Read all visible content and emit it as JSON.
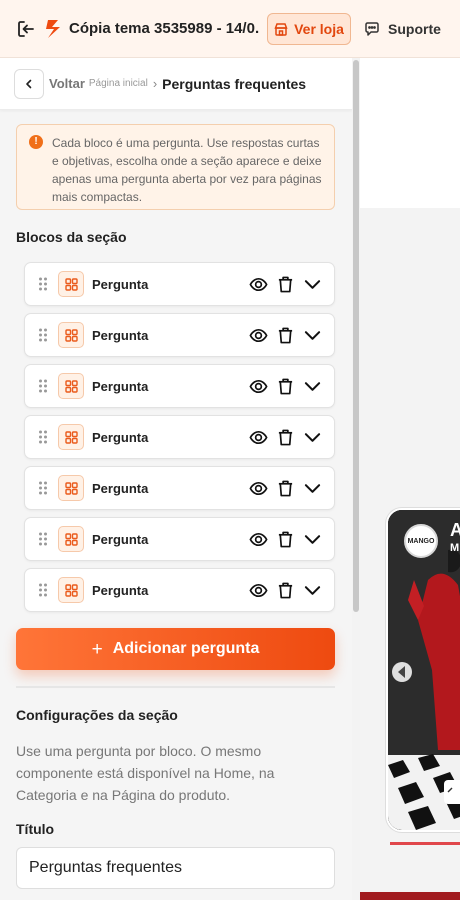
{
  "topbar": {
    "title": "Cópia tema 3535989 - 14/0...",
    "ver_loja": "Ver loja",
    "suporte": "Suporte",
    "accent": "#e2470e"
  },
  "breadcrumb": {
    "voltar": "Voltar",
    "home": "Página inicial",
    "separator": "›",
    "current": "Perguntas frequentes"
  },
  "info": {
    "icon": "!",
    "text": "Cada bloco é uma pergunta. Use respostas curtas e objetivas, escolha onde a seção aparece e deixe apenas uma pergunta aberta por vez para páginas mais compactas."
  },
  "blocks": {
    "heading": "Blocos da seção",
    "items": [
      {
        "label": "Pergunta"
      },
      {
        "label": "Pergunta"
      },
      {
        "label": "Pergunta"
      },
      {
        "label": "Pergunta"
      },
      {
        "label": "Pergunta"
      },
      {
        "label": "Pergunta"
      },
      {
        "label": "Pergunta"
      }
    ]
  },
  "add_button": {
    "plus": "+",
    "label": "Adicionar pergunta"
  },
  "settings": {
    "heading": "Configurações da seção",
    "description": "Use uma pergunta por bloco. O mesmo componente está disponível na Home, na Categoria e na Página do produto.",
    "title_label": "Título",
    "title_value": "Perguntas frequentes"
  },
  "preview": {
    "brand_logo": "MANGO",
    "headline_fragment": "A",
    "sub_fragment": "M"
  }
}
